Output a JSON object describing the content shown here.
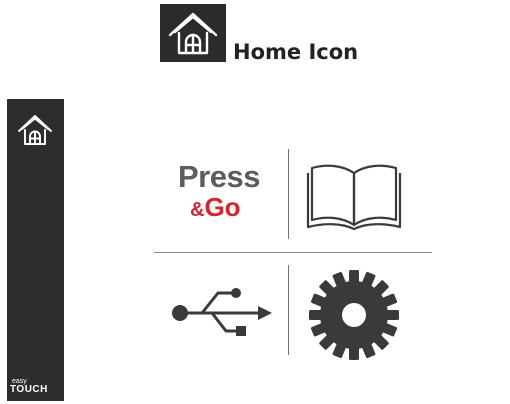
{
  "legend": {
    "icon": "home-icon",
    "caption": "Home Icon"
  },
  "sidebar": {
    "home_icon": "home-icon",
    "brand_small": "easy",
    "brand_big": "TOUCH"
  },
  "menu": {
    "press_go": {
      "word1": "Press",
      "amp": "&",
      "word2": "Go"
    },
    "manual_icon": "open-book-icon",
    "usb_icon": "usb-icon",
    "settings_icon": "gear-icon"
  },
  "colors": {
    "sidebar_bg": "#2d2d2d",
    "press_gray": "#5c5c5c",
    "go_red": "#d8232a",
    "icon_dark": "#3a3a3a"
  }
}
